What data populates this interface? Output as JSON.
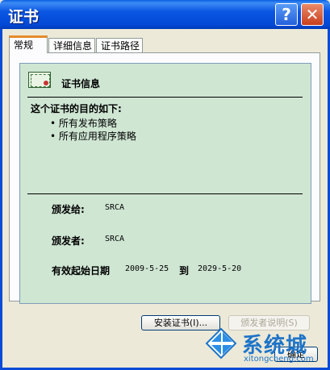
{
  "window": {
    "title": "证书"
  },
  "tabs": [
    {
      "label": "常规",
      "active": true
    },
    {
      "label": "详细信息",
      "active": false
    },
    {
      "label": "证书路径",
      "active": false
    }
  ],
  "certificate": {
    "heading": "证书信息",
    "purpose_title": "这个证书的目的如下:",
    "purposes": [
      "• 所有发布策略",
      "• 所有应用程序策略"
    ],
    "issued_to_label": "颁发给:",
    "issued_to_value": "SRCA",
    "issued_by_label": "颁发者:",
    "issued_by_value": "SRCA",
    "valid_label": "有效起始日期",
    "valid_from": "2009-5-25",
    "to_label": "到",
    "valid_to": "2029-5-20"
  },
  "buttons": {
    "install": "安装证书(I)...",
    "issuer_statement": "颁发者说明(S)",
    "ok": "确定"
  },
  "watermark": {
    "brand": "系统城",
    "url": "xitongcheng.com"
  },
  "colors": {
    "title_bar": "#0349d6",
    "panel_green": "#cfe6d3",
    "tab_accent": "#e68b2c"
  }
}
